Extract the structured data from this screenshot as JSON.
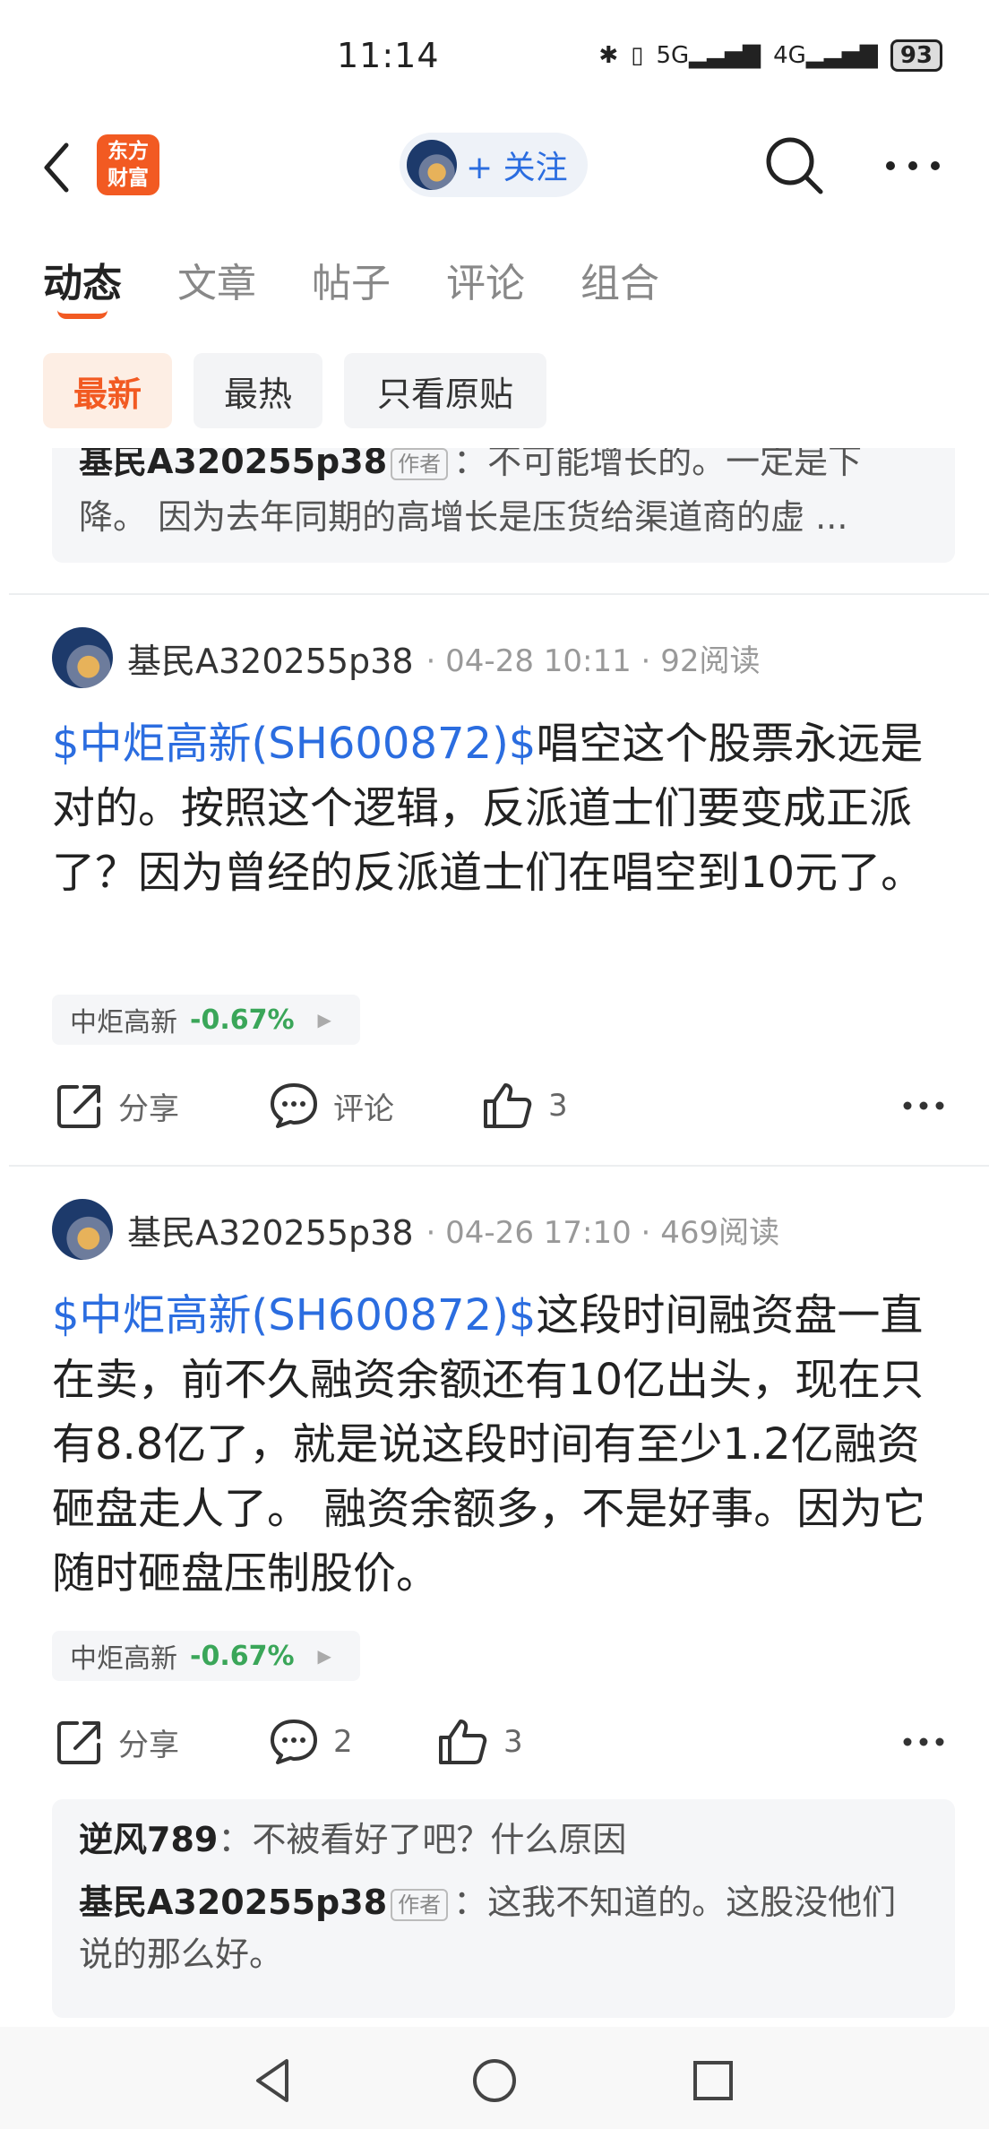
{
  "status_bar": {
    "time": "11:14",
    "signal_5g": "5G",
    "signal_4g": "4G",
    "battery": "93"
  },
  "header": {
    "logo_line1": "东方",
    "logo_line2": "财富",
    "follow_label": "+ 关注",
    "brand_color": "#f25a22",
    "accent_color": "#2b6de0"
  },
  "tabs": [
    {
      "label": "动态",
      "active": true
    },
    {
      "label": "文章",
      "active": false
    },
    {
      "label": "帖子",
      "active": false
    },
    {
      "label": "评论",
      "active": false
    },
    {
      "label": "组合",
      "active": false
    }
  ],
  "filters": [
    {
      "label": "最新",
      "active": true
    },
    {
      "label": "最热",
      "active": false
    },
    {
      "label": "只看原贴",
      "active": false
    }
  ],
  "top_reply": {
    "author": "基民A320255p38",
    "author_tag": "作者",
    "line1": "：不可能增长的。一定是下",
    "line2": "降。  因为去年同期的高增长是压货给渠道商的虚 ..."
  },
  "posts": [
    {
      "author": "基民A320255p38",
      "date": "04-28 10:11",
      "reads": "92阅读",
      "stock_link": "$中炬高新(SH600872)$",
      "body": "唱空这个股票永远是对的。按照这个逻辑，反派道士们要变成正派了？因为曾经的反派道士们在唱空到10元了。",
      "stock_name": "中炬高新",
      "stock_change": "-0.67%",
      "share_label": "分享",
      "comment_label": "评论",
      "like_count": "3"
    },
    {
      "author": "基民A320255p38",
      "date": "04-26 17:10",
      "reads": "469阅读",
      "stock_link": "$中炬高新(SH600872)$",
      "body": "这段时间融资盘一直在卖，前不久融资余额还有10亿出头，现在只有8.8亿了，就是说这段时间有至少1.2亿融资砸盘走人了。  融资余额多，不是好事。因为它随时砸盘压制股价。",
      "stock_name": "中炬高新",
      "stock_change": "-0.67%",
      "share_label": "分享",
      "comment_label": "2",
      "like_count": "3",
      "replies": [
        {
          "author": "逆风789",
          "tag": "",
          "text": "：不被看好了吧？什么原因"
        },
        {
          "author": "基民A320255p38",
          "tag": "作者",
          "text": "：这我不知道的。这股没他们说的那么好。"
        }
      ]
    }
  ]
}
